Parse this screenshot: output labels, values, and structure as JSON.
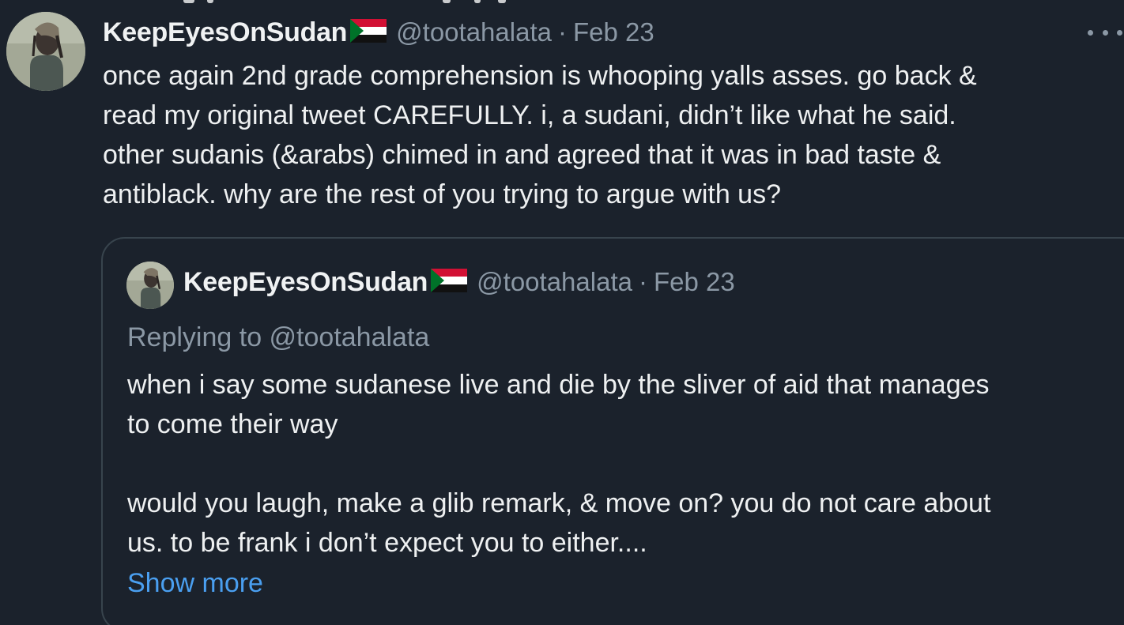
{
  "tweet": {
    "author": {
      "display_name": "KeepEyesOnSudan",
      "flag_icon": "sudan-flag-icon",
      "handle": "@tootahalata",
      "separator": "·",
      "date": "Feb 23"
    },
    "text": "once again 2nd grade comprehension is whooping yalls asses. go back &\nread my original tweet CAREFULLY. i, a sudani, didn’t like what he said.\nother sudanis (&arabs) chimed in and agreed that it was in bad taste &\nantiblack. why are the rest of you trying to argue with us?",
    "more_icon": "more-horizontal-icon"
  },
  "quoted_tweet": {
    "author": {
      "display_name": "KeepEyesOnSudan",
      "flag_icon": "sudan-flag-icon",
      "handle": "@tootahalata",
      "separator": "·",
      "date": "Feb 23"
    },
    "replying_prefix": "Replying to ",
    "replying_to": "@tootahalata",
    "text": "when i say some sudanese live and die by the sliver of aid that manages\nto come their way\n\nwould you laugh, make a glib remark, & move on? you do not care about\nus. to be frank i don’t expect you to either....",
    "show_more_label": "Show more"
  },
  "colors": {
    "background": "#1b222c",
    "primary_text": "#eef0f1",
    "secondary_text": "#8b98a5",
    "link": "#4a9ff0",
    "border": "#38444d"
  }
}
